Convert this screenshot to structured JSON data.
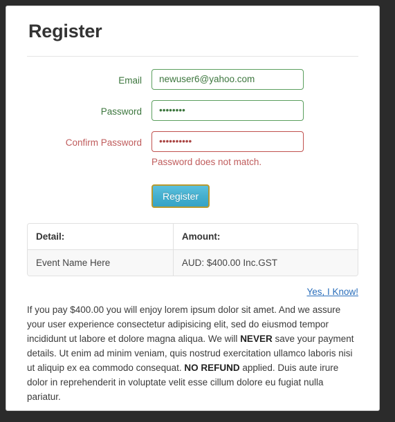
{
  "page": {
    "title": "Register"
  },
  "form": {
    "email": {
      "label": "Email",
      "value": "newuser6@yahoo.com",
      "placeholder": "",
      "state": "valid"
    },
    "password": {
      "label": "Password",
      "value": "••••••••",
      "placeholder": "",
      "state": "valid"
    },
    "confirm_password": {
      "label": "Confirm Password",
      "value": "••••••••••",
      "placeholder": "",
      "state": "error",
      "error_message": "Password does not match."
    },
    "submit_label": "Register"
  },
  "table": {
    "headers": [
      "Detail:",
      "Amount:"
    ],
    "rows": [
      [
        "Event Name Here",
        "AUD: $400.00 Inc.GST"
      ]
    ]
  },
  "link": {
    "label": "Yes, I Know!"
  },
  "legal": {
    "part1": "If you pay $400.00 you will enjoy lorem ipsum dolor sit amet. And we assure your user experience consectetur adipisicing elit, sed do eiusmod tempor incididunt ut labore et dolore magna aliqua. We will ",
    "bold1": "NEVER",
    "part2": " save your payment details. Ut enim ad minim veniam, quis nostrud exercitation ullamco laboris nisi ut aliquip ex ea commodo consequat. ",
    "bold2": "NO REFUND",
    "part3": " applied. Duis aute irure dolor in reprehenderit in voluptate velit esse cillum dolore eu fugiat nulla pariatur."
  },
  "colors": {
    "valid": "#3c763d",
    "error": "#a94442",
    "link": "#2a6ebb",
    "button": "#43aecd",
    "button_focus_outline": "#b8992e"
  }
}
